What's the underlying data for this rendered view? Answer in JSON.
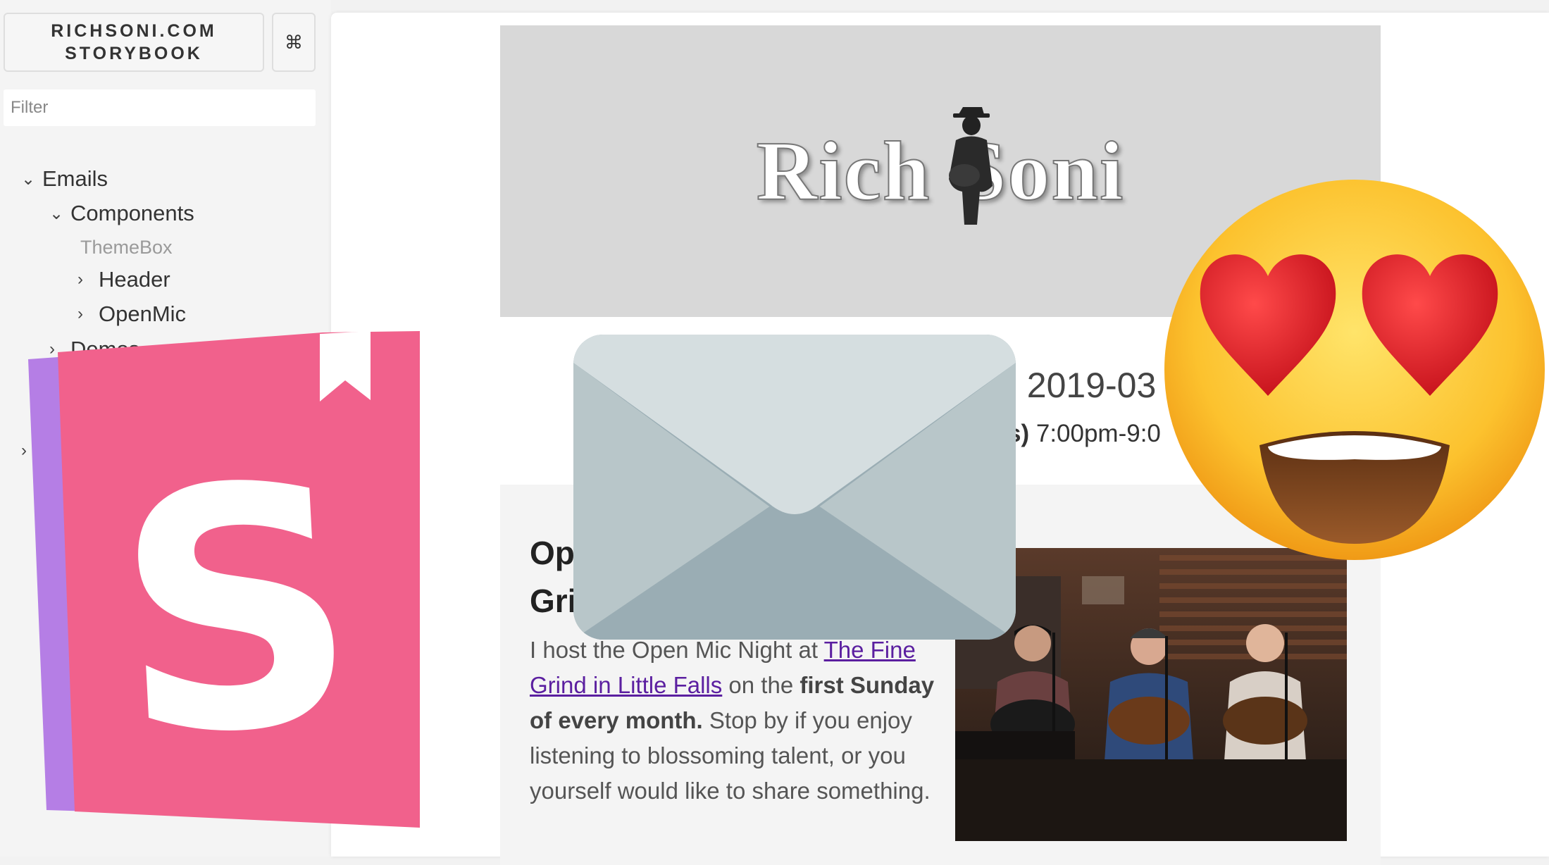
{
  "sidebar": {
    "brand": "RICHSONI.COM\nSTORYBOOK",
    "shortcut_label": "⌘",
    "filter_placeholder": "Filter",
    "tree": {
      "emails": "Emails",
      "components": "Components",
      "themebox": "ThemeBox",
      "header": "Header",
      "openmic": "OpenMic",
      "demos": "Demos"
    }
  },
  "preview": {
    "logo_left": "Rich",
    "logo_right": "Soni",
    "date_fragment": ", 2019-03",
    "time_prefix": "s)",
    "time_fragment": " 7:00pm-9:0",
    "card": {
      "title_line1": "Op",
      "title_line2": "Gri",
      "body_prefix": "I host the Open Mic Night at ",
      "body_link": "The Fine Grind in Little Falls",
      "body_mid": " on the ",
      "body_bold": "first Sunday of every month.",
      "body_suffix": " Stop by if you enjoy listening to blossoming talent, or you yourself would like to share something."
    }
  },
  "overlays": {
    "storybook_logo_letter": "S",
    "storybook_color": "#F1618C",
    "storybook_accent": "#B57EE5",
    "envelope_colors": [
      "#d5dee0",
      "#b8c6c9",
      "#9aadb4"
    ],
    "emoji": "heart-eyes-emoji"
  }
}
